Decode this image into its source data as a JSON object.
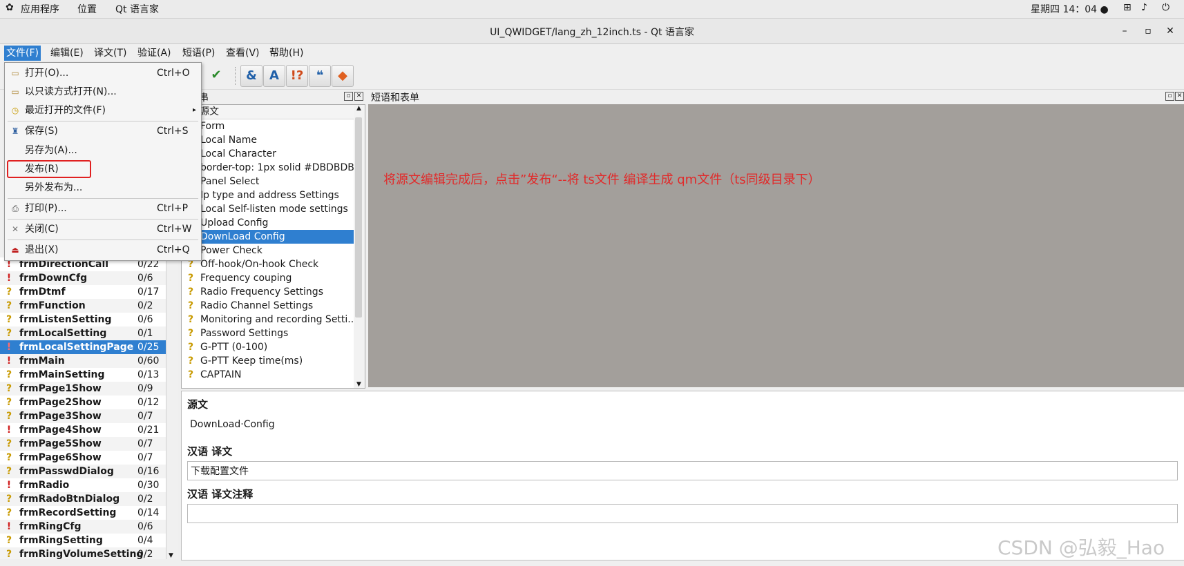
{
  "system_bar": {
    "apps_label": "应用程序",
    "places_label": "位置",
    "active_app": "Qt 语言家",
    "clock": "星期四 14：04 ●"
  },
  "window": {
    "title": "UI_QWIDGET/lang_zh_12inch.ts - Qt 语言家",
    "min": "–",
    "max": "▫",
    "close": "✕"
  },
  "menubar": [
    "文件(F)",
    "编辑(E)",
    "译文(T)",
    "验证(A)",
    "短语(P)",
    "查看(V)",
    "帮助(H)"
  ],
  "file_menu": [
    {
      "label": "打开(O)...",
      "shortcut": "Ctrl+O",
      "icon": "folder-open-icon"
    },
    {
      "label": "以只读方式打开(N)...",
      "shortcut": "",
      "icon": "folder-open-icon"
    },
    {
      "label": "最近打开的文件(F)",
      "shortcut": "",
      "icon": "clock-icon",
      "submenu": "▸"
    },
    {
      "label": "保存(S)",
      "shortcut": "Ctrl+S",
      "icon": "save-icon"
    },
    {
      "label": "另存为(A)...",
      "shortcut": "",
      "icon": ""
    },
    {
      "label": "发布(R)",
      "shortcut": "",
      "icon": "",
      "highlighted": true
    },
    {
      "label": "另外发布为...",
      "shortcut": "",
      "icon": ""
    },
    {
      "label": "打印(P)...",
      "shortcut": "Ctrl+P",
      "icon": "printer-icon"
    },
    {
      "label": "关闭(C)",
      "shortcut": "Ctrl+W",
      "icon": "close-icon"
    },
    {
      "label": "退出(X)",
      "shortcut": "Ctrl+Q",
      "icon": "exit-icon"
    }
  ],
  "toolbar_icons": [
    "phrase-icon",
    "check-icon",
    "accelerator-icon",
    "text-icon",
    "punctuation-icon",
    "quotes-icon",
    "placeholder-icon"
  ],
  "context_list": [
    {
      "status": "!",
      "name": "frmDirectionCall",
      "count": "0/22"
    },
    {
      "status": "!",
      "name": "frmDownCfg",
      "count": "0/6"
    },
    {
      "status": "?",
      "name": "frmDtmf",
      "count": "0/17"
    },
    {
      "status": "?",
      "name": "frmFunction",
      "count": "0/2"
    },
    {
      "status": "?",
      "name": "frmListenSetting",
      "count": "0/6"
    },
    {
      "status": "?",
      "name": "frmLocalSetting",
      "count": "0/1"
    },
    {
      "status": "!",
      "name": "frmLocalSettingPage",
      "count": "0/25",
      "selected": true
    },
    {
      "status": "!",
      "name": "frmMain",
      "count": "0/60"
    },
    {
      "status": "?",
      "name": "frmMainSetting",
      "count": "0/13"
    },
    {
      "status": "?",
      "name": "frmPage1Show",
      "count": "0/9"
    },
    {
      "status": "?",
      "name": "frmPage2Show",
      "count": "0/12"
    },
    {
      "status": "?",
      "name": "frmPage3Show",
      "count": "0/7"
    },
    {
      "status": "!",
      "name": "frmPage4Show",
      "count": "0/21"
    },
    {
      "status": "?",
      "name": "frmPage5Show",
      "count": "0/7"
    },
    {
      "status": "?",
      "name": "frmPage6Show",
      "count": "0/7"
    },
    {
      "status": "?",
      "name": "frmPasswdDialog",
      "count": "0/16"
    },
    {
      "status": "!",
      "name": "frmRadio",
      "count": "0/30"
    },
    {
      "status": "?",
      "name": "frmRadoBtnDialog",
      "count": "0/2"
    },
    {
      "status": "?",
      "name": "frmRecordSetting",
      "count": "0/14"
    },
    {
      "status": "!",
      "name": "frmRingCfg",
      "count": "0/6"
    },
    {
      "status": "?",
      "name": "frmRingSetting",
      "count": "0/4"
    },
    {
      "status": "?",
      "name": "frmRingVolumeSetting",
      "count": "0/2"
    }
  ],
  "strings_panel": {
    "title": "串",
    "header": "源文",
    "rows": [
      {
        "status": "",
        "text": "Form"
      },
      {
        "status": "",
        "text": "Local Name"
      },
      {
        "status": "",
        "text": "Local Character"
      },
      {
        "status": "",
        "text": "border-top: 1px solid #DBDBDB;"
      },
      {
        "status": "",
        "text": "Panel Select"
      },
      {
        "status": "",
        "text": "Ip type and address Settings"
      },
      {
        "status": "",
        "text": "Local Self-listen mode settings"
      },
      {
        "status": "",
        "text": "Upload Config"
      },
      {
        "status": "",
        "text": "DownLoad Config",
        "selected": true
      },
      {
        "status": "",
        "text": "Power Check"
      },
      {
        "status": "?",
        "text": "Off-hook/On-hook Check"
      },
      {
        "status": "?",
        "text": "Frequency couping"
      },
      {
        "status": "?",
        "text": "Radio Frequency Settings"
      },
      {
        "status": "?",
        "text": "Radio Channel Settings"
      },
      {
        "status": "?",
        "text": "Monitoring and recording Setti..."
      },
      {
        "status": "?",
        "text": "Password Settings"
      },
      {
        "status": "?",
        "text": "G-PTT (0-100)"
      },
      {
        "status": "?",
        "text": "G-PTT Keep time(ms)"
      },
      {
        "status": "?",
        "text": "CAPTAIN"
      }
    ]
  },
  "phrases_panel": {
    "title": "短语和表单",
    "annotation": "将源文编辑完成后，点击”发布“--将 ts文件 编译生成 qm文件（ts同级目录下）"
  },
  "editor": {
    "source_label": "源文",
    "source_text": "DownLoad·Config",
    "translation_label": "汉语 译文",
    "translation_value": "下载配置文件",
    "comment_label": "汉语 译文注释",
    "comment_value": ""
  },
  "watermark": "CSDN @弘毅_Hao",
  "colors": {
    "selection": "#2f7fd0",
    "annotation": "#e02b2b",
    "phrases_bg": "#a39f9b"
  }
}
